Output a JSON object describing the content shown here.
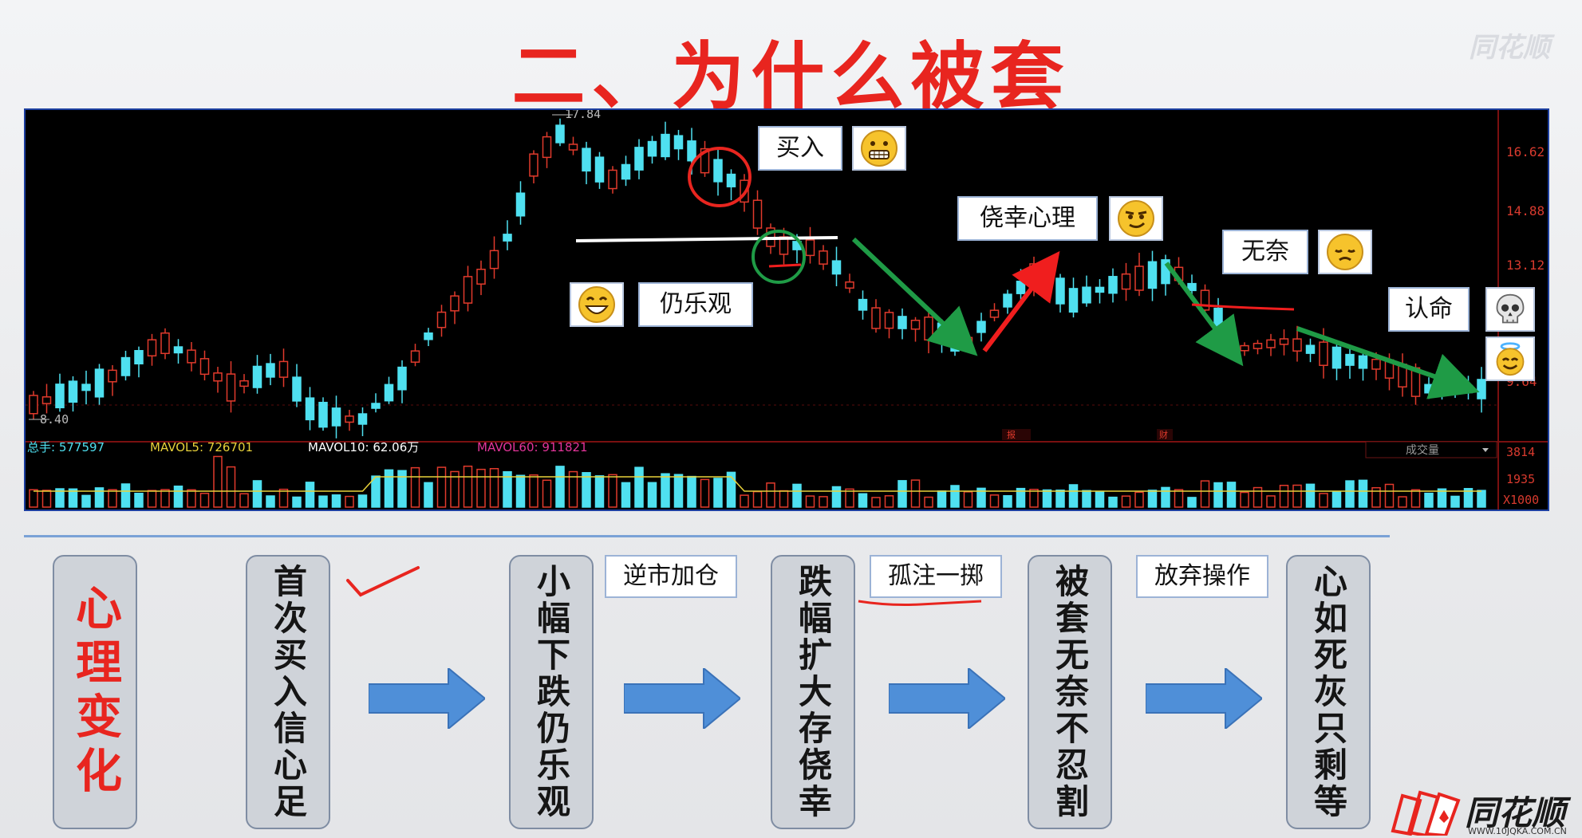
{
  "slide": {
    "title": "二、为什么被套",
    "watermark": "同花顺"
  },
  "chart": {
    "price_high_label": "17.84",
    "price_low_label": "8.40",
    "price_axis": [
      "16.62",
      "14.88",
      "13.12",
      "9.64"
    ],
    "volume_axis": [
      "3814",
      "1935",
      "X1000"
    ],
    "volume_legend": {
      "total": "总手: 577597",
      "mavol5": "MAVOL5: 726701",
      "mavol10": "MAVOL10: 62.06万",
      "mavol60": "MAVOL60: 911821"
    },
    "volume_dropdown": "成交量",
    "markers": [
      "报",
      "财"
    ],
    "colors": {
      "up": "#e13a2c",
      "down": "#4fe0f0",
      "ma5": "#ffffff",
      "ma10": "#e8d23a",
      "ma60": "#e3359a",
      "price_axis_text": "#d83a2e",
      "trend_down": "#1f9b46",
      "trend_up": "#f01e1e"
    }
  },
  "callouts": {
    "buy": "买入",
    "optimistic": "仍乐观",
    "fluke": "侥幸心理",
    "helpless": "无奈",
    "resigned": "认命"
  },
  "emoji_icons": [
    "grinning-teeth-icon",
    "big-smile-icon",
    "smirk-icon",
    "pensive-icon",
    "skull-icon",
    "halo-icon"
  ],
  "flow": {
    "mind_label": "心理变化",
    "stages": [
      "首次买入信心足",
      "小幅下跌仍乐观",
      "跌幅扩大存侥幸",
      "被套无奈不忍割",
      "心如死灰只剩等"
    ],
    "actions": [
      "逆市加仓",
      "孤注一掷",
      "放弃操作"
    ]
  },
  "logo": {
    "text": "同花顺",
    "url": "WWW.10JQKA.COM.CN"
  }
}
